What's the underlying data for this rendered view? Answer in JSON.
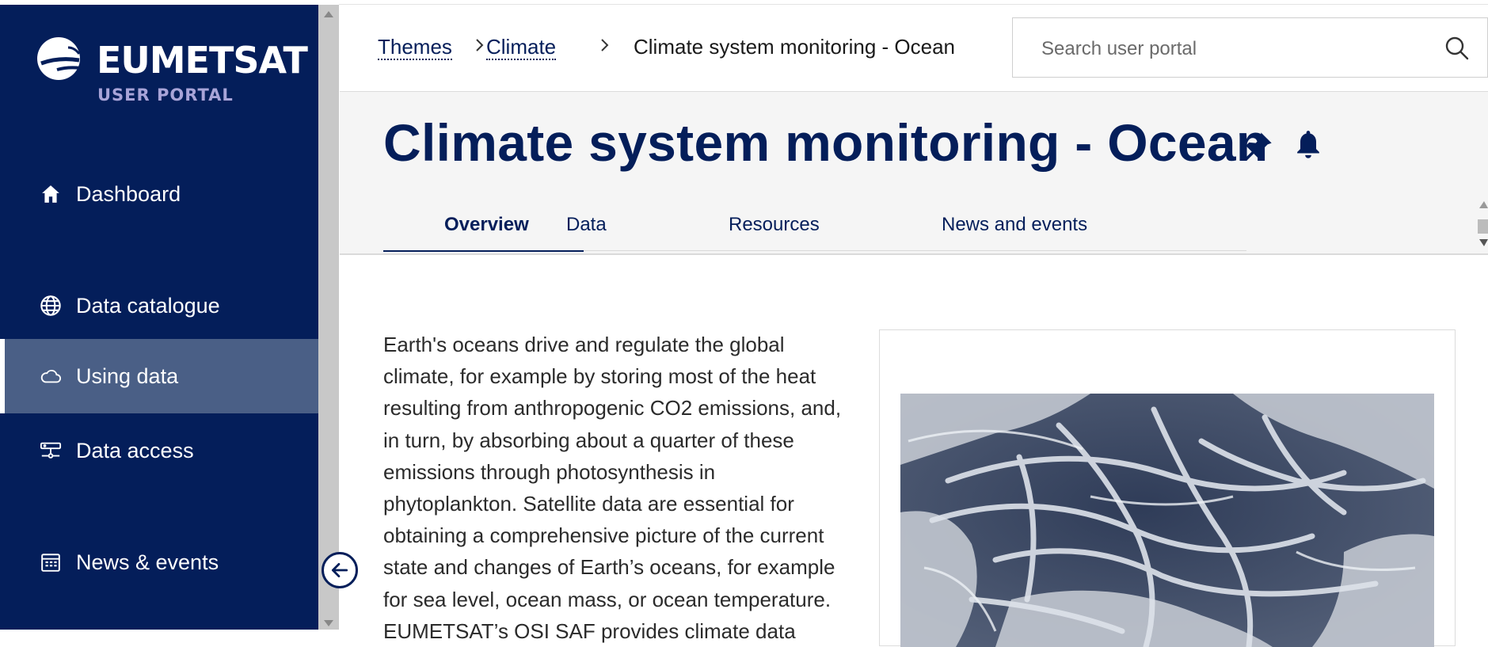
{
  "brand": {
    "name": "EUMETSAT",
    "subtitle": "USER PORTAL"
  },
  "sidebar": {
    "items": [
      {
        "label": "Dashboard",
        "icon": "home-icon"
      },
      {
        "label": "Data catalogue",
        "icon": "globe-icon"
      },
      {
        "label": "Using data",
        "icon": "cloud-icon",
        "active": true
      },
      {
        "label": "Data access",
        "icon": "server-icon"
      },
      {
        "label": "News & events",
        "icon": "calendar-icon"
      }
    ]
  },
  "breadcrumb": {
    "items": [
      "Themes",
      "Climate"
    ],
    "current": "Climate system monitoring - Ocean"
  },
  "search": {
    "placeholder": "Search user portal"
  },
  "page": {
    "title": "Climate system monitoring - Ocean",
    "tabs": [
      "Overview",
      "Data",
      "Resources",
      "News and events"
    ],
    "active_tab": "Overview",
    "body_lines": [
      "Earth's oceans drive and regulate the global",
      "climate, for example by storing most of the heat",
      "resulting from anthropogenic CO2 emissions, and,",
      "in turn, by absorbing about a quarter of these",
      "emissions through photosynthesis in",
      "phytoplankton. Satellite data are essential for",
      "obtaining a comprehensive picture of the current",
      "state and changes of Earth’s oceans, for example",
      "for sea level, ocean mass, or ocean temperature.",
      "EUMETSAT’s OSI SAF provides climate data"
    ]
  },
  "colors": {
    "navy": "#041e5a",
    "active_nav": "#4a5f86",
    "logo_sub": "#a8a4d8"
  }
}
